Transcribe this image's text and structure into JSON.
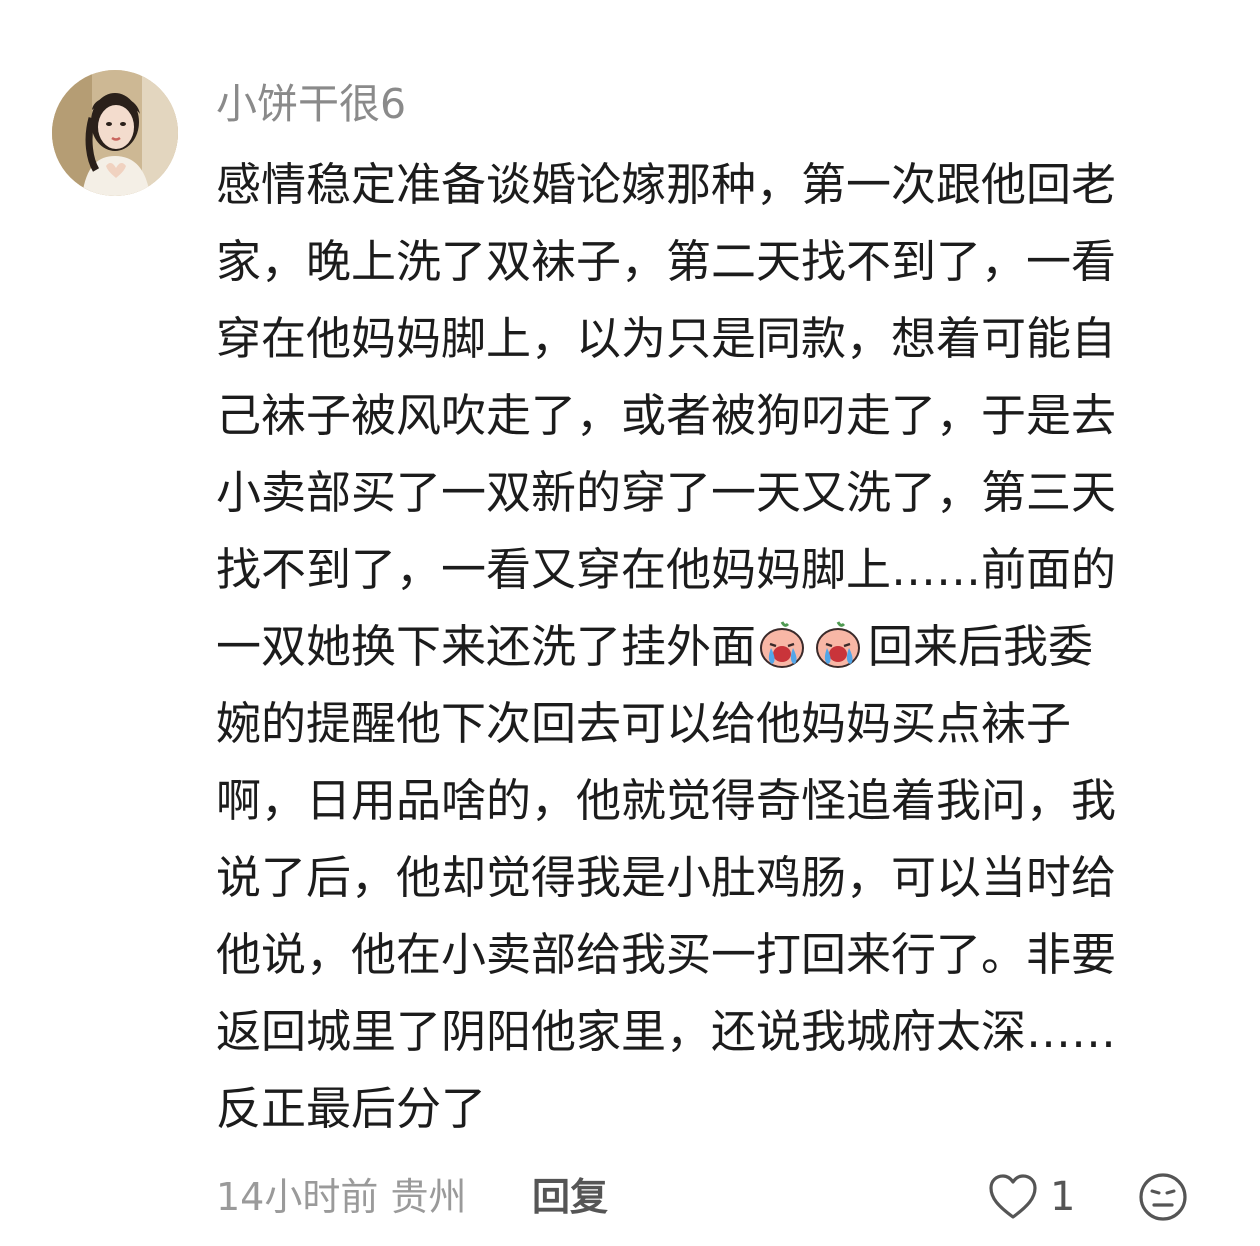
{
  "comment": {
    "username": "小饼干很6",
    "avatar_icon": "user-avatar-photo",
    "lines": [
      "感情稳定准备谈婚论嫁那种，第一次跟他回老",
      "家，晚上洗了双袜子，第二天找不到了，一看",
      "穿在他妈妈脚上，以为只是同款，想着可能自",
      "己袜子被风吹走了，或者被狗叼走了，于是去",
      "小卖部买了一双新的穿了一天又洗了，第三天",
      "找不到了，一看又穿在他妈妈脚上……前面的"
    ],
    "line7_before": "一双她换下来还洗了挂外面",
    "line7_emoji": "crying-emoji",
    "line7_after": "回来后我委",
    "lines_after": [
      "婉的提醒他下次回去可以给他妈妈买点袜子",
      "啊，日用品啥的，他就觉得奇怪追着我问，我",
      "说了后，他却觉得我是小肚鸡肠，可以当时给",
      "他说，他在小卖部给我买一打回来行了。非要",
      "返回城里了阴阳他家里，还说我城府太深……",
      "反正最后分了"
    ],
    "footer": {
      "time": "14小时前",
      "location": "贵州",
      "reply_label": "回复",
      "like_icon": "heart-outline-icon",
      "like_count": "1",
      "dislike_icon": "neutral-face-icon"
    }
  }
}
